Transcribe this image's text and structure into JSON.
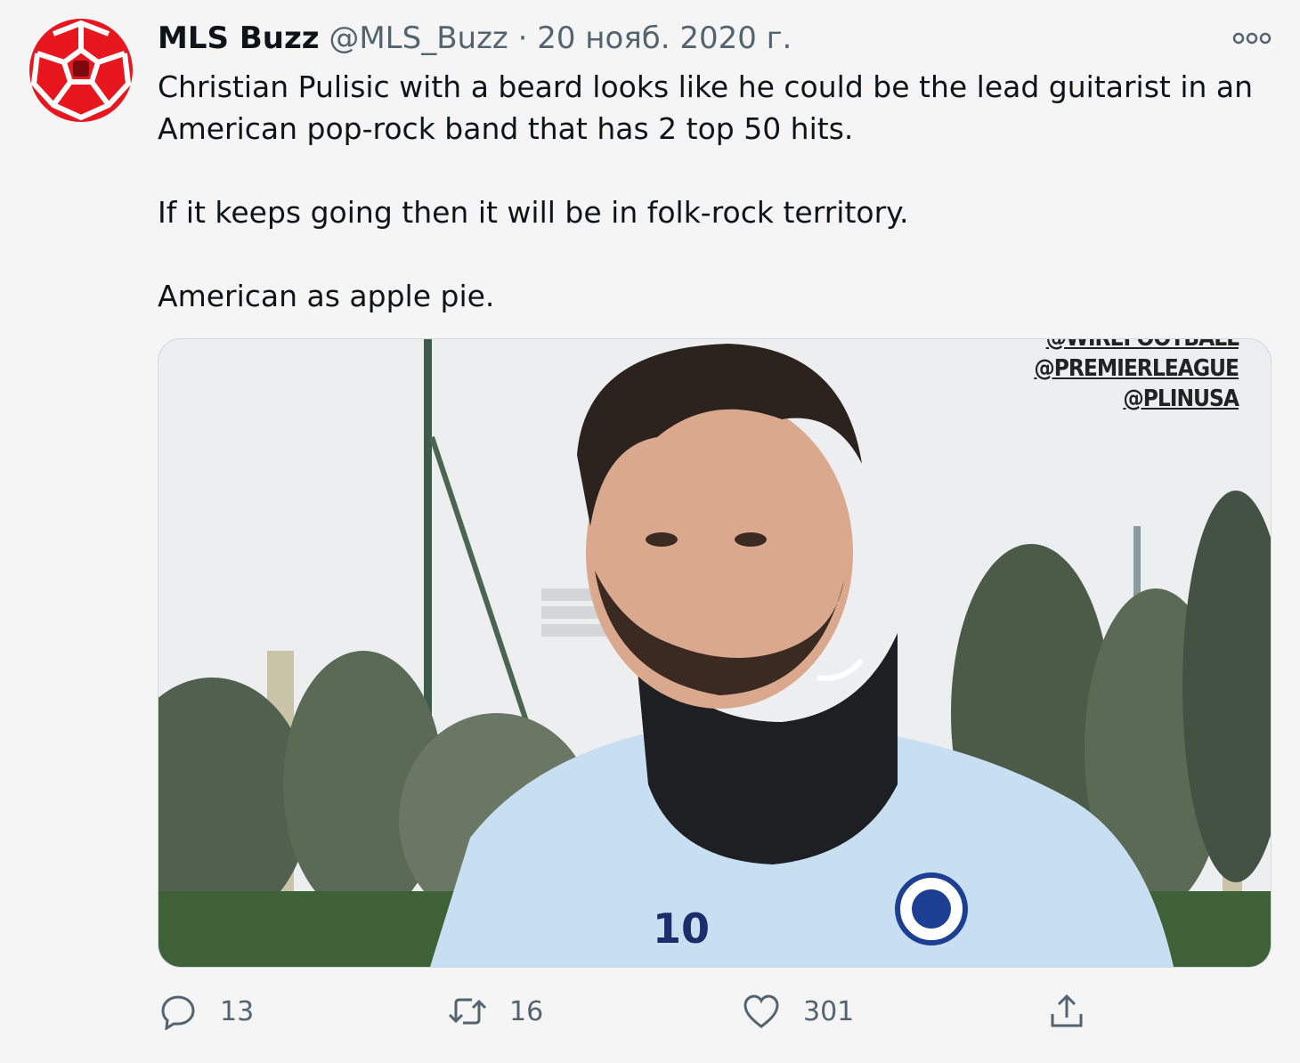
{
  "tweet": {
    "author_name": "MLS Buzz",
    "author_handle": "@MLS_Buzz",
    "separator": "·",
    "date": "20 нояб. 2020 г.",
    "text_lines": [
      "Christian Pulisic with a beard looks like he could be the lead guitarist in an",
      "American pop-rock band that has 2 top 50 hits.",
      "If it keeps going then it will be in folk-rock territory.",
      "American as apple pie."
    ],
    "media": {
      "watermark_lines": [
        "@WIREFOOTBALL",
        "@PREMIERLEAGUE",
        "@PLINUSA"
      ],
      "shirt_number": "10"
    },
    "actions": {
      "reply_count": "13",
      "retweet_count": "16",
      "like_count": "301"
    },
    "colors": {
      "avatar_red": "#e8161e",
      "muted_text": "#536471",
      "shirt_blue": "#c7dff0"
    }
  },
  "icons": {
    "more": "more-dots-icon",
    "reply": "reply-bubble-icon",
    "retweet": "retweet-arrows-icon",
    "like": "heart-icon",
    "share": "share-upload-icon"
  }
}
